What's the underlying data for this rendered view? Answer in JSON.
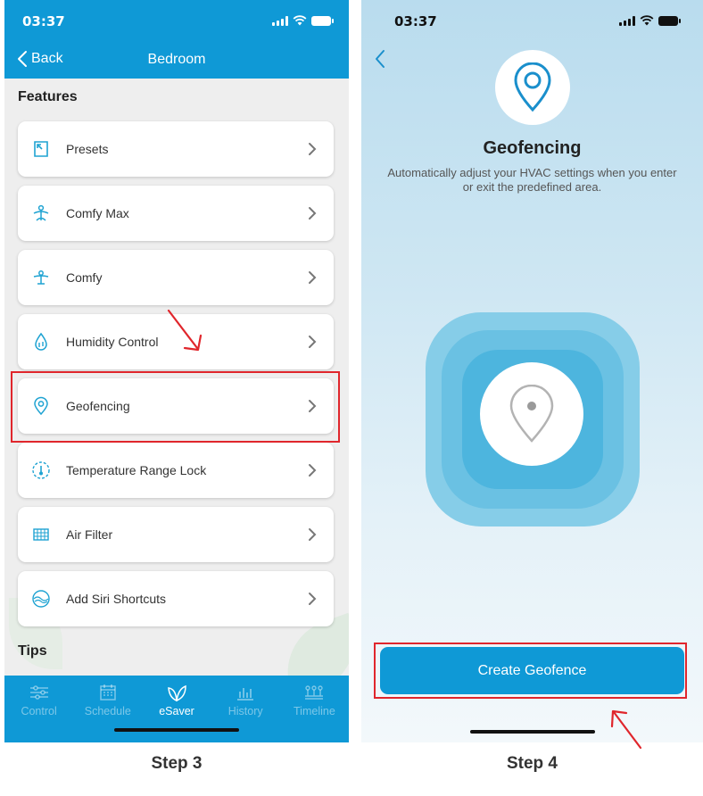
{
  "left_screen": {
    "status": {
      "time": "03:37"
    },
    "nav": {
      "back_label": "Back",
      "title": "Bedroom"
    },
    "section_features": "Features",
    "features": [
      {
        "label": "Presets",
        "icon": "presets-icon"
      },
      {
        "label": "Comfy Max",
        "icon": "comfy-max-icon"
      },
      {
        "label": "Comfy",
        "icon": "comfy-icon"
      },
      {
        "label": "Humidity Control",
        "icon": "humidity-icon"
      },
      {
        "label": "Geofencing",
        "icon": "location-pin-icon"
      },
      {
        "label": "Temperature Range Lock",
        "icon": "thermometer-lock-icon"
      },
      {
        "label": "Air Filter",
        "icon": "air-filter-icon"
      },
      {
        "label": "Add Siri Shortcuts",
        "icon": "siri-icon"
      }
    ],
    "section_tips": "Tips",
    "tabs": [
      {
        "label": "Control",
        "icon": "sliders-icon",
        "active": false
      },
      {
        "label": "Schedule",
        "icon": "calendar-icon",
        "active": false
      },
      {
        "label": "eSaver",
        "icon": "leaf-icon",
        "active": true
      },
      {
        "label": "History",
        "icon": "bar-chart-icon",
        "active": false
      },
      {
        "label": "Timeline",
        "icon": "timeline-icon",
        "active": false
      }
    ]
  },
  "right_screen": {
    "status": {
      "time": "03:37"
    },
    "title": "Geofencing",
    "description": "Automatically adjust your HVAC settings when you enter or exit the predefined area.",
    "create_button_label": "Create Geofence"
  },
  "captions": {
    "step3": "Step 3",
    "step4": "Step 4"
  },
  "colors": {
    "brand_blue": "#0f99d6",
    "highlight_red": "#e0262c",
    "icon_teal": "#1fa3d2"
  }
}
